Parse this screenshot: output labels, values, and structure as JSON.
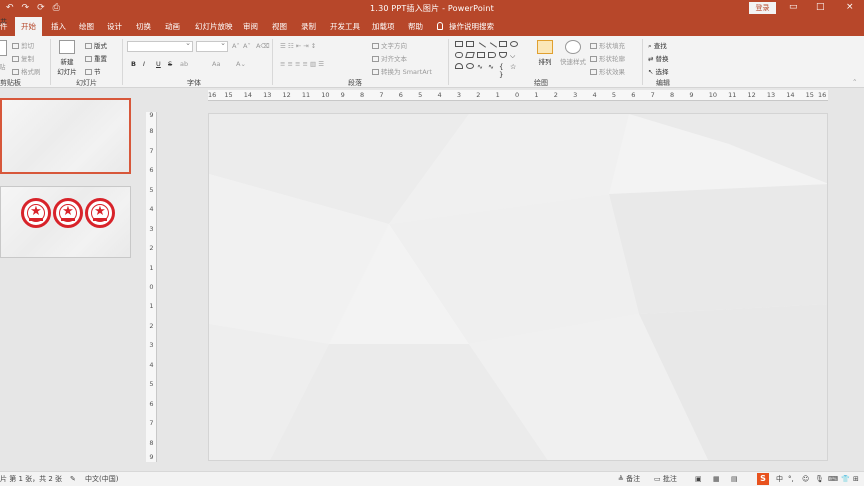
{
  "titlebar": {
    "qat": [
      "↶",
      "↷",
      "⟳",
      "⎙"
    ],
    "title": "1.30 PPT插入图片 - PowerPoint",
    "login": "登录",
    "minimize": "—",
    "restore": "□",
    "close": "×"
  },
  "tabs": [
    {
      "label": "件"
    },
    {
      "label": "开始"
    },
    {
      "label": "插入"
    },
    {
      "label": "绘图"
    },
    {
      "label": "设计"
    },
    {
      "label": "切换"
    },
    {
      "label": "动画"
    },
    {
      "label": "幻灯片放映"
    },
    {
      "label": "审阅"
    },
    {
      "label": "视图"
    },
    {
      "label": "录制"
    },
    {
      "label": "开发工具"
    },
    {
      "label": "加载项"
    },
    {
      "label": "帮助"
    }
  ],
  "tell_me": "操作说明搜索",
  "ribbon": {
    "clipboard": {
      "cut": "剪切",
      "copy": "复制",
      "format_painter": "格式刷",
      "paste": "粘贴",
      "label": "剪贴板"
    },
    "slides": {
      "new_slide_1": "新建",
      "new_slide_2": "幻灯片",
      "layout": "版式",
      "reset": "重置",
      "section": "节",
      "label": "幻灯片"
    },
    "font": {
      "bold": "B",
      "italic": "I",
      "underline": "U",
      "strike": "S",
      "spacing": "ab",
      "grow": "A",
      "shrink": "A",
      "clear": "A",
      "change_case": "Aa",
      "label": "字体"
    },
    "paragraph": {
      "text_direction": "文字方向",
      "align_text": "对齐文本",
      "smartart": "转换为 SmartArt",
      "label": "段落"
    },
    "drawing": {
      "arrange": "排列",
      "quick_styles": "快速样式",
      "shape_fill": "形状填充",
      "shape_outline": "形状轮廓",
      "shape_effects": "形状效果",
      "label": "绘图"
    },
    "editing": {
      "find": "查找",
      "replace": "替换",
      "select": "选择",
      "label": "编辑"
    }
  },
  "thumbnails": [
    {
      "num": "1",
      "selected": true
    },
    {
      "num": "2",
      "selected": false
    }
  ],
  "hruler_labels": [
    "16",
    "15",
    "14",
    "13",
    "12",
    "11",
    "10",
    "9",
    "8",
    "7",
    "6",
    "5",
    "4",
    "3",
    "2",
    "1",
    "0",
    "1",
    "2",
    "3",
    "4",
    "5",
    "6",
    "7",
    "8",
    "9",
    "10",
    "11",
    "12",
    "13",
    "14",
    "15",
    "16"
  ],
  "vruler_labels": [
    "9",
    "8",
    "7",
    "6",
    "5",
    "4",
    "3",
    "2",
    "1",
    "0",
    "1",
    "2",
    "3",
    "4",
    "5",
    "6",
    "7",
    "8",
    "9"
  ],
  "status": {
    "slide_info": "片 第 1 张，共 2 张",
    "language": "中文(中国)",
    "notes": "备注",
    "comments": "批注",
    "ime_cn": "中",
    "ime_punct": "°,"
  },
  "colors": {
    "accent": "#b7472a",
    "stamp_red": "#d8232a"
  }
}
